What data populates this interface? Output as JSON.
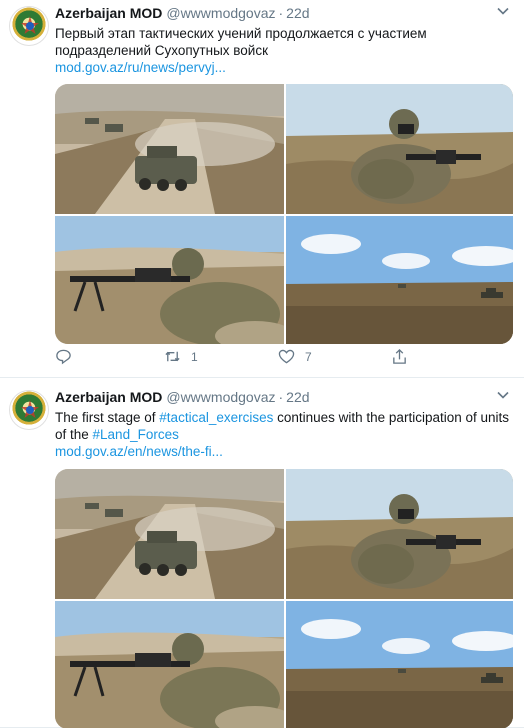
{
  "colors": {
    "link": "#1b95e0",
    "secondary": "#657786",
    "divider": "#e6ecf0"
  },
  "tweets": [
    {
      "author_name": "Azerbaijan MOD",
      "handle": "@wwwmodgovaz",
      "separator": "·",
      "time": "22d",
      "text_line1": "Первый этап тактических учений продолжается с участием",
      "text_line2": "подразделений Сухопутных войск",
      "link": "mod.gov.az/ru/news/pervyj...",
      "reply_count": "",
      "retweet_count": "1",
      "like_count": "7",
      "icons": [
        "reply-icon",
        "retweet-icon",
        "like-icon",
        "share-icon",
        "chevron-down-icon"
      ]
    },
    {
      "author_name": "Azerbaijan MOD",
      "handle": "@wwwmodgovaz",
      "separator": "·",
      "time": "22d",
      "text_pre": "The first stage of ",
      "hashtag1": "#tactical_exercises",
      "text_mid": " continues with the participation of units",
      "text_line2_pre": "of the ",
      "hashtag2": "#Land_Forces",
      "link": "mod.gov.az/en/news/the-fi...",
      "icons": [
        "chevron-down-icon"
      ]
    }
  ]
}
